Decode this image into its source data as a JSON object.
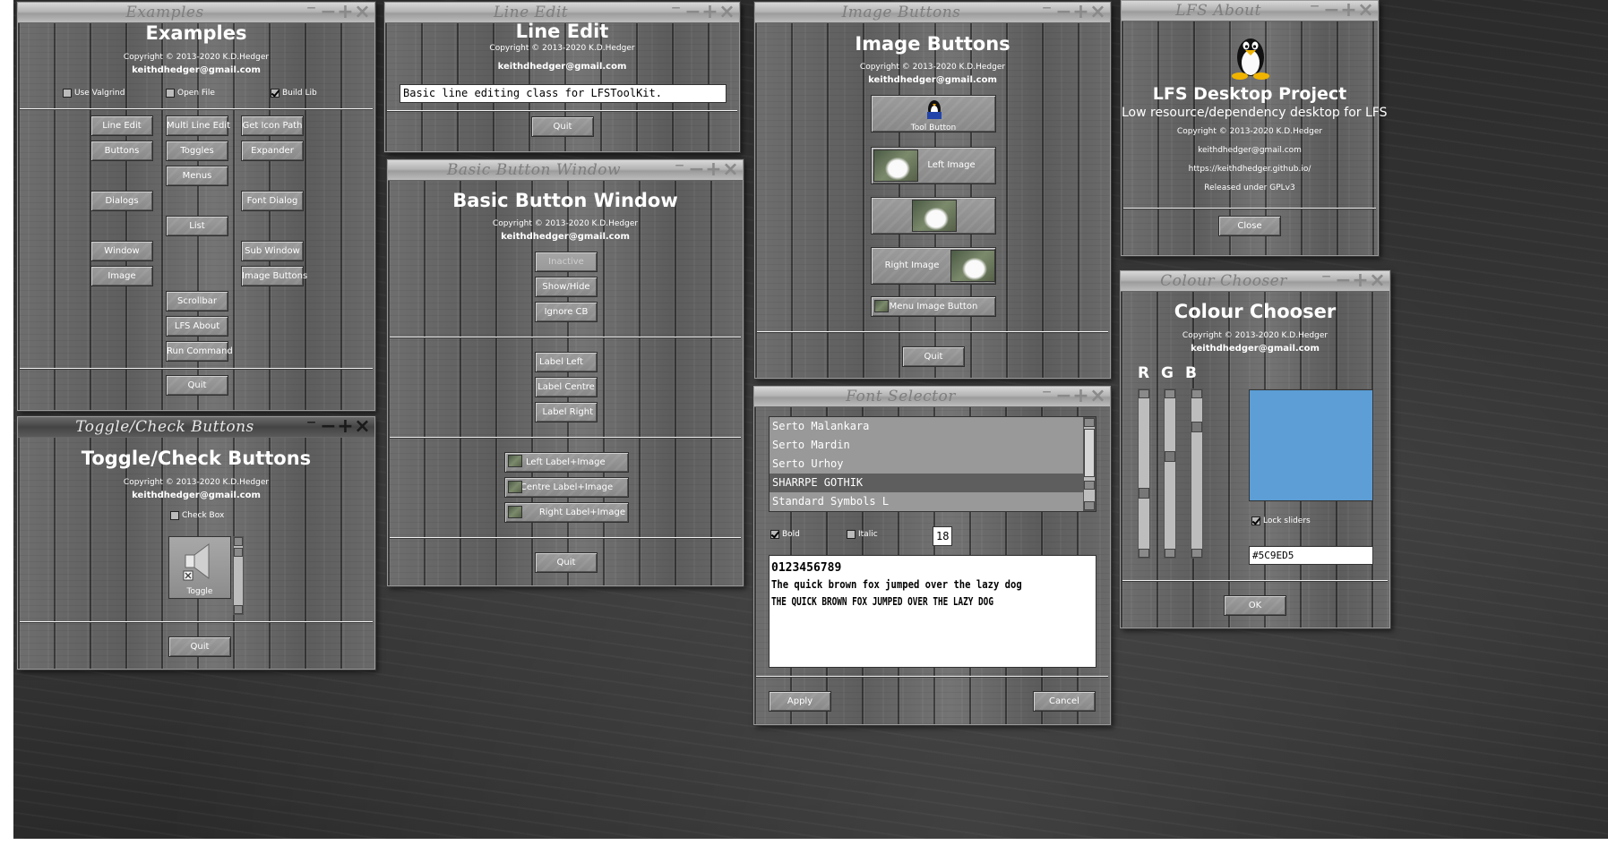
{
  "colors": {
    "swatch": "#5C9ED5"
  },
  "examples": {
    "title_bar": "Examples",
    "heading": "Examples",
    "copyright": "Copyright © 2013-2020 K.D.Hedger",
    "email": "keithdhedger@gmail.com",
    "checks": {
      "valgrind": "Use Valgrind",
      "open_file": "Open File",
      "build_lib": "Build Lib"
    },
    "buttons": {
      "line_edit": "Line Edit",
      "multi_line_edit": "Multi Line Edit",
      "get_icon_path": "Get Icon Path",
      "buttons": "Buttons",
      "toggles": "Toggles",
      "expander": "Expander",
      "menus": "Menus",
      "dialogs": "Dialogs",
      "font_dialog": "Font Dialog",
      "list": "List",
      "window": "Window",
      "sub_window": "Sub Window",
      "image": "Image",
      "image_buttons": "Image Buttons",
      "scrollbar": "Scrollbar",
      "lfs_about": "LFS About",
      "run_command": "Run Command",
      "quit": "Quit"
    }
  },
  "toggle": {
    "title_bar": "Toggle/Check Buttons",
    "heading": "Toggle/Check Buttons",
    "copyright": "Copyright © 2013-2020 K.D.Hedger",
    "email": "keithdhedger@gmail.com",
    "check_box": "Check Box",
    "toggle_label": "Toggle",
    "quit": "Quit"
  },
  "line_edit": {
    "title_bar": "Line Edit",
    "heading": "Line Edit",
    "copyright": "Copyright © 2013-2020 K.D.Hedger",
    "email": "keithdhedger@gmail.com",
    "value": "Basic line editing class for LFSToolKit.",
    "quit": "Quit"
  },
  "basic_button": {
    "title_bar": "Basic Button Window",
    "heading": "Basic Button Window",
    "copyright": "Copyright © 2013-2020 K.D.Hedger",
    "email": "keithdhedger@gmail.com",
    "inactive": "Inactive",
    "show_hide": "Show/Hide",
    "ignore_cb": "Ignore CB",
    "label_left": "Label Left",
    "label_centre": "Label Centre",
    "label_right": "Label Right",
    "left_label_image": "Left Label+Image",
    "centre_label_image": "Centre Label+Image",
    "right_label_image": "Right Label+Image",
    "quit": "Quit"
  },
  "image_buttons": {
    "title_bar": "Image Buttons",
    "heading": "Image Buttons",
    "copyright": "Copyright © 2013-2020 K.D.Hedger",
    "email": "keithdhedger@gmail.com",
    "tool_button": "Tool Button",
    "left_image": "Left Image",
    "right_image": "Right Image",
    "menu_image_button": "Menu Image Button",
    "quit": "Quit"
  },
  "font_selector": {
    "title_bar": "Font Selector",
    "fonts": [
      "Serto Malankara",
      "Serto Mardin",
      "Serto Urhoy",
      "SHARRPE GOTHIK",
      "Standard Symbols L"
    ],
    "selected_index": 3,
    "bold": "Bold",
    "italic": "Italic",
    "size": "18",
    "preview": [
      "0123456789",
      "The quick brown fox jumped over the lazy dog",
      "THE QUICK BROWN FOX JUMPED OVER THE LAZY DOG"
    ],
    "apply": "Apply",
    "cancel": "Cancel"
  },
  "lfs_about": {
    "title_bar": "LFS About",
    "heading": "LFS Desktop Project",
    "subtitle": "Low resource/dependency desktop for LFS",
    "copyright": "Copyright © 2013-2020 K.D.Hedger",
    "email": "keithdhedger@gmail.com",
    "url": "https://keithdhedger.github.io/",
    "license": "Released under GPLv3",
    "close": "Close"
  },
  "colour_chooser": {
    "title_bar": "Colour Chooser",
    "heading": "Colour Chooser",
    "copyright": "Copyright © 2013-2020 K.D.Hedger",
    "email": "keithdhedger@gmail.com",
    "r_label": "R",
    "g_label": "G",
    "b_label": "B",
    "r_value": 92,
    "g_value": 158,
    "b_value": 213,
    "lock_sliders": "Lock sliders",
    "hex": "#5C9ED5",
    "ok": "OK"
  },
  "window_controls": {
    "shade": "⁻",
    "minimize": "−",
    "maximize": "+",
    "close": "×"
  }
}
